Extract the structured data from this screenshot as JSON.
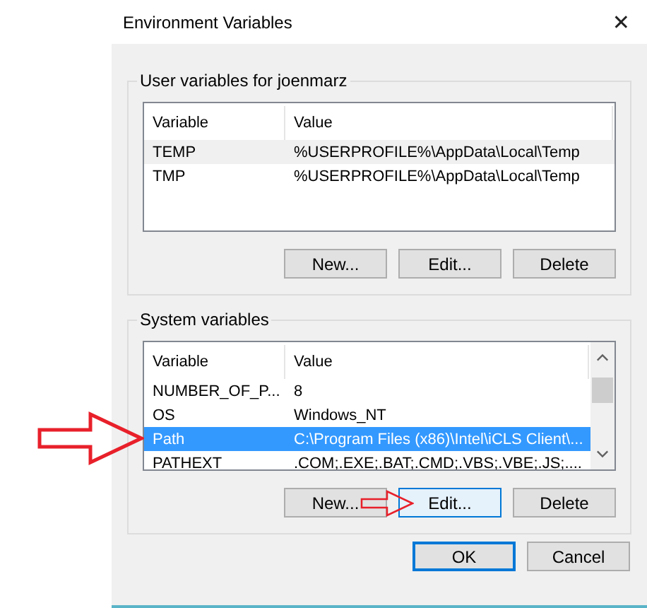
{
  "window": {
    "title": "Environment Variables",
    "close": "✕"
  },
  "panels": [
    {
      "title": "User variables for joenmarz",
      "focused": false,
      "scrollbar": false,
      "columns": [
        "Variable",
        "Value"
      ],
      "rows": [
        {
          "cells": [
            "TEMP",
            "%USERPROFILE%\\AppData\\Local\\Temp"
          ],
          "selected": true
        },
        {
          "cells": [
            "TMP",
            "%USERPROFILE%\\AppData\\Local\\Temp"
          ],
          "selected": false
        }
      ],
      "buttons": [
        {
          "label": "New...",
          "hover": false
        },
        {
          "label": "Edit...",
          "hover": false
        },
        {
          "label": "Delete",
          "hover": false
        }
      ]
    },
    {
      "title": "System variables",
      "focused": true,
      "scrollbar": true,
      "columns": [
        "Variable",
        "Value"
      ],
      "rows": [
        {
          "cells": [
            "NUMBER_OF_P...",
            "8"
          ],
          "selected": false
        },
        {
          "cells": [
            "OS",
            "Windows_NT"
          ],
          "selected": false
        },
        {
          "cells": [
            "Path",
            "C:\\Program Files (x86)\\Intel\\iCLS Client\\..."
          ],
          "selected": true
        },
        {
          "cells": [
            "PATHEXT",
            ".COM;.EXE;.BAT;.CMD;.VBS;.VBE;.JS;...."
          ],
          "selected": false
        }
      ],
      "buttons": [
        {
          "label": "New...",
          "hover": false
        },
        {
          "label": "Edit...",
          "hover": true
        },
        {
          "label": "Delete",
          "hover": false
        }
      ]
    }
  ],
  "buttons": [
    {
      "label": "OK",
      "default": true
    },
    {
      "label": "Cancel",
      "default": false
    }
  ]
}
